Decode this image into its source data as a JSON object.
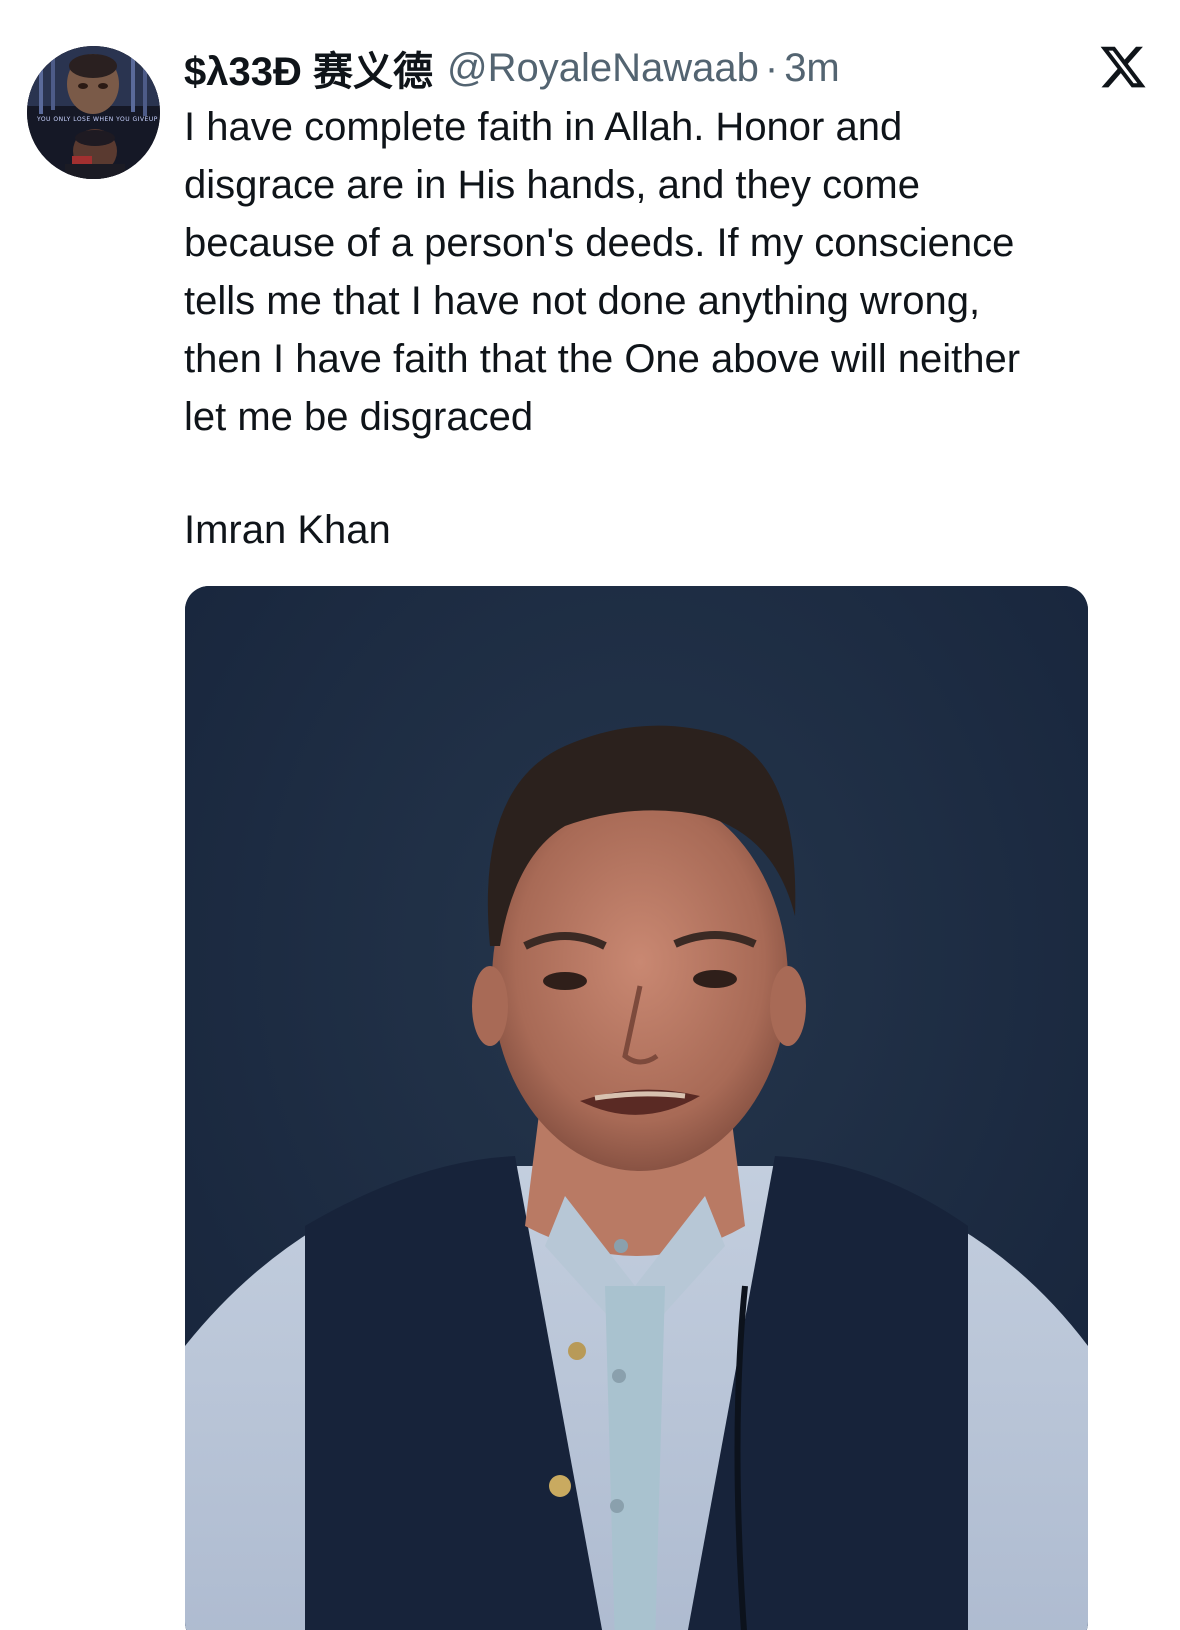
{
  "tweet": {
    "display_name": "$λ33Đ 赛义德",
    "handle": "@RoyaleNawaab",
    "separator": "·",
    "time": "3m",
    "text": "I have complete faith in Allah. Honor and\ndisgrace are in His hands, and they come\nbecause of a person's deeds. If my conscience\ntells me that I have not done anything wrong,\nthen I have faith that the One above will neither\nlet me be disgraced",
    "attribution": "Imran Khan"
  },
  "avatar": {
    "text": "YOU ONLY LOSE WHEN YOU GIVEUP"
  },
  "icons": {
    "brand": "x-logo-icon"
  },
  "colors": {
    "text": "#0f1419",
    "secondary": "#536471",
    "media_background": "#1d2b3d"
  }
}
